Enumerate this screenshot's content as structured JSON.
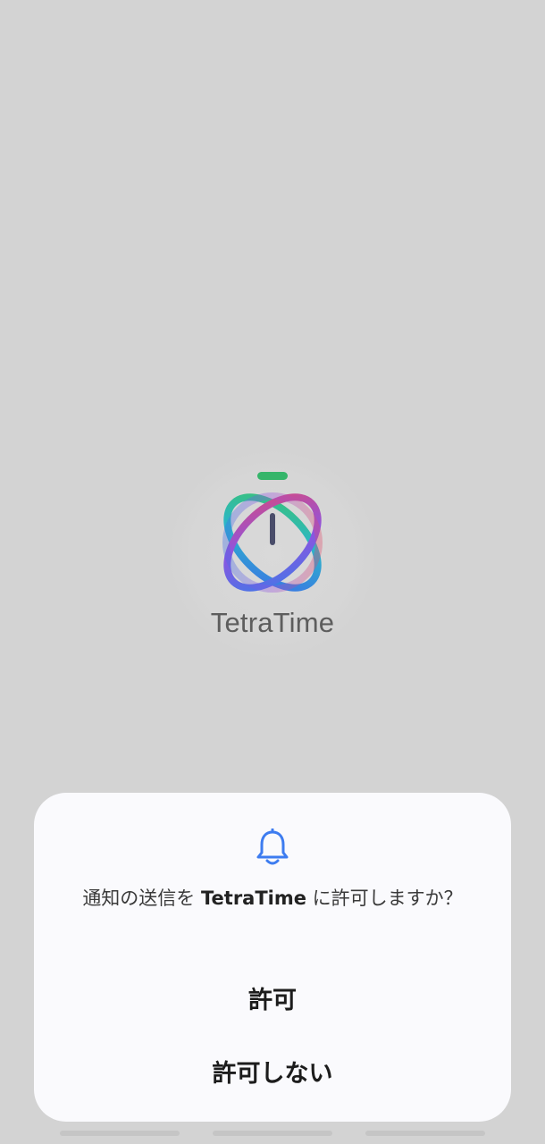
{
  "splash": {
    "app_name": "TetraTime",
    "logo_icon": "stopwatch-orbit-logo"
  },
  "dialog": {
    "icon": "bell-icon",
    "accent_color": "#3d7cf0",
    "message_prefix": "通知の送信を ",
    "message_app": "TetraTime",
    "message_suffix": " に許可しますか？",
    "allow_label": "許可",
    "deny_label": "許可しない"
  }
}
